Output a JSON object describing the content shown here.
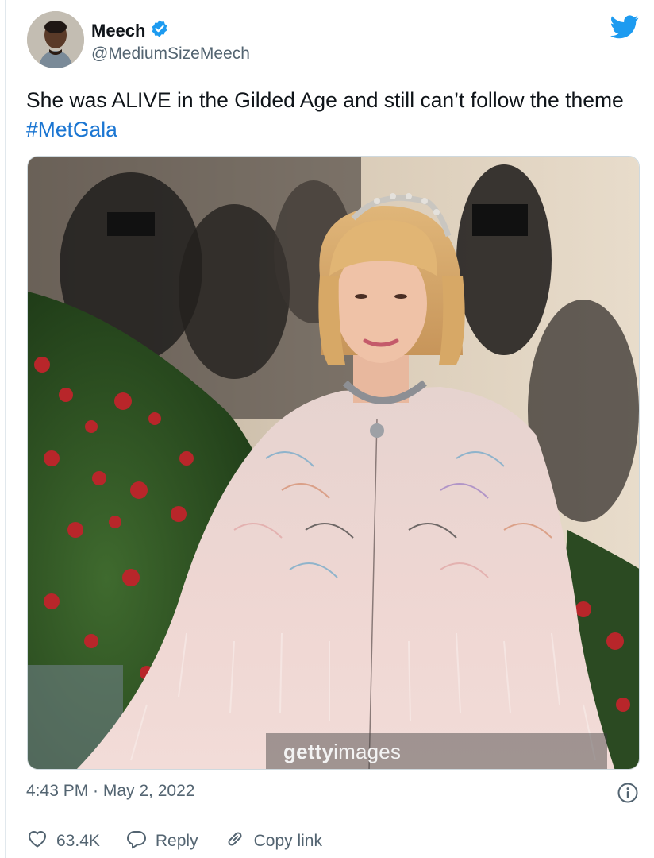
{
  "author": {
    "display_name": "Meech",
    "handle": "@MediumSizeMeech",
    "verified": true
  },
  "tweet": {
    "text_prefix": "She was ALIVE in the Gilded Age and still can’t follow the theme ",
    "hashtag": "#MetGala"
  },
  "media": {
    "watermark_bold": "getty",
    "watermark_light": "images"
  },
  "meta": {
    "timestamp": "4:43 PM · May 2, 2022"
  },
  "actions": {
    "like_count": "63.4K",
    "reply_label": "Reply",
    "copy_link_label": "Copy link"
  },
  "colors": {
    "brand_blue": "#1d9bf0",
    "hashtag_blue": "#1b76d2",
    "muted_text": "#536471"
  },
  "icons": [
    "verified-badge-icon",
    "twitter-bird-icon",
    "info-icon",
    "heart-icon",
    "reply-icon",
    "link-icon"
  ]
}
